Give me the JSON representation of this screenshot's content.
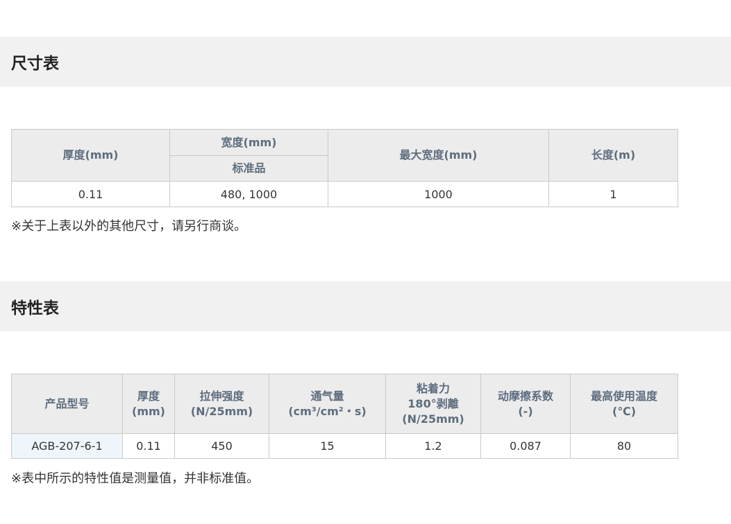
{
  "size_section": {
    "title": "尺寸表",
    "headers": {
      "thickness": "厚度(mm)",
      "width": "宽度(mm)",
      "width_sub": "标准品",
      "max_width": "最大宽度(mm)",
      "length": "长度(m)"
    },
    "row": {
      "thickness": "0.11",
      "width": "480, 1000",
      "max_width": "1000",
      "length": "1"
    },
    "note": "※关于上表以外的其他尺寸，请另行商谈。"
  },
  "props_section": {
    "title": "特性表",
    "headers": {
      "model": "产品型号",
      "thickness_1": "厚度",
      "thickness_2": "(mm)",
      "tensile_1": "拉伸强度",
      "tensile_2": "(N/25mm)",
      "air_1": "通气量",
      "air_2": "(cm³/cm²・s)",
      "adhesion_1": "粘着力",
      "adhesion_2": "180°剥離",
      "adhesion_3": "(N/25mm)",
      "friction_1": "动摩擦系数",
      "friction_2": "(-)",
      "temp_1": "最高使用温度",
      "temp_2": "(℃)"
    },
    "row": {
      "model": "AGB-207-6-1",
      "thickness": "0.11",
      "tensile": "450",
      "air": "15",
      "adhesion": "1.2",
      "friction": "0.087",
      "temp": "80"
    },
    "note": "※表中所示的特性值是测量值，并非标准值。"
  }
}
